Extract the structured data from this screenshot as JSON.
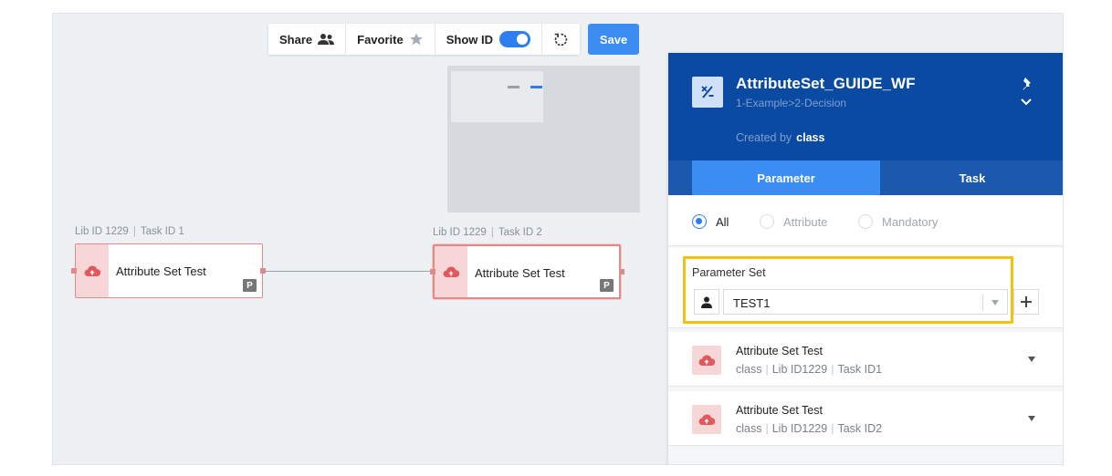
{
  "toolbar": {
    "share_label": "Share",
    "favorite_label": "Favorite",
    "show_id_label": "Show ID",
    "show_id_on": true,
    "save_label": "Save"
  },
  "nodes": [
    {
      "lib_id": "Lib ID 1229",
      "task_id": "Task ID 1",
      "title": "Attribute Set Test",
      "badge": "P",
      "selected": false
    },
    {
      "lib_id": "Lib ID 1229",
      "task_id": "Task ID 2",
      "title": "Attribute Set Test",
      "badge": "P",
      "selected": true
    }
  ],
  "panel": {
    "workflow_name": "AttributeSet_GUIDE_WF",
    "workflow_path": "1-Example>2-Decision",
    "created_by_label": "Created by",
    "created_by_user": "class",
    "tabs": {
      "parameter": "Parameter",
      "task": "Task"
    },
    "filters": {
      "all": "All",
      "attribute": "Attribute",
      "mandatory": "Mandatory",
      "selected": "all"
    },
    "parameter_set": {
      "label": "Parameter Set",
      "value": "TEST1"
    },
    "tasks": [
      {
        "name": "Attribute Set Test",
        "user": "class",
        "lib": "Lib ID1229",
        "task": "Task ID1"
      },
      {
        "name": "Attribute Set Test",
        "user": "class",
        "lib": "Lib ID1229",
        "task": "Task ID2"
      }
    ]
  },
  "colors": {
    "accent": "#3b8cf3",
    "header": "#0b4aa2",
    "node_border": "#e28a8a",
    "highlight": "#f4c20d"
  }
}
